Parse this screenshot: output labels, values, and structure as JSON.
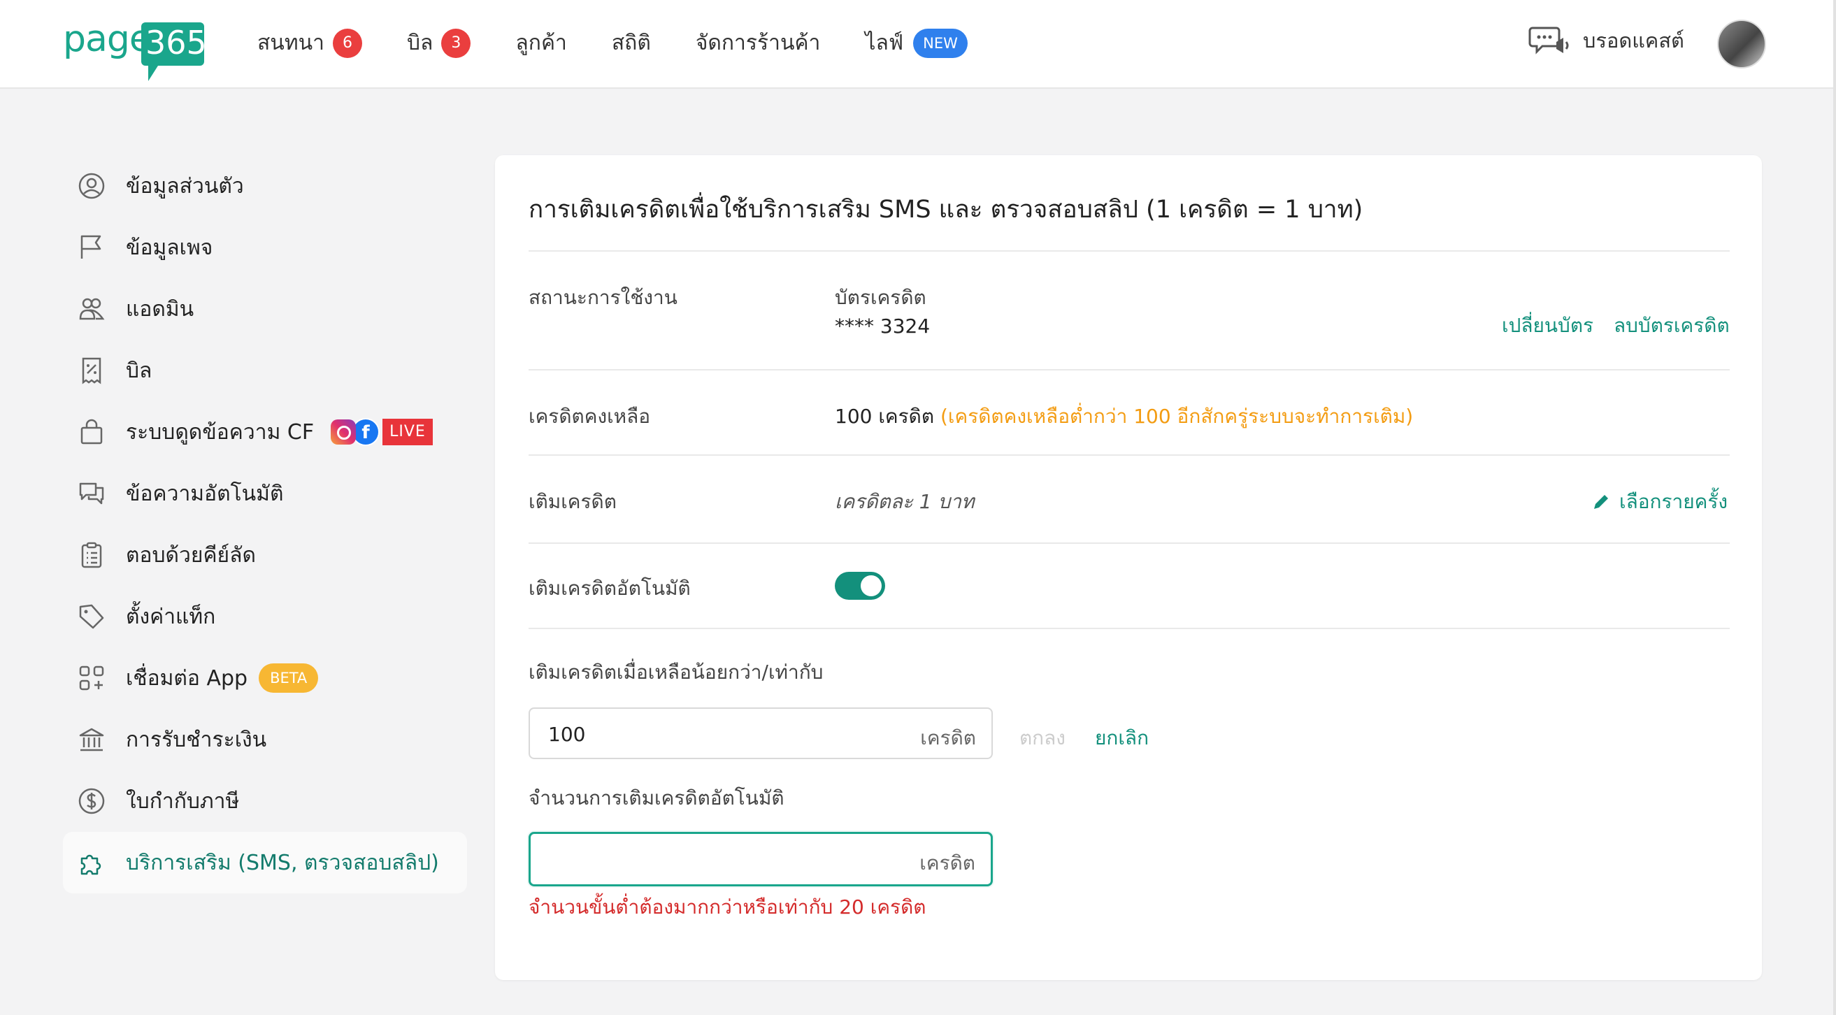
{
  "logo": {
    "text_page": "page",
    "text_365": "365"
  },
  "nav": [
    {
      "label": "สนทนา",
      "badge": "6"
    },
    {
      "label": "บิล",
      "badge": "3"
    },
    {
      "label": "ลูกค้า"
    },
    {
      "label": "สถิติ"
    },
    {
      "label": "จัดการร้านค้า"
    },
    {
      "label": "ไลฟ์",
      "tag": "NEW"
    }
  ],
  "header": {
    "broadcast_label": "บรอดแคสต์",
    "broadcast_icon": "megaphone-chat-icon"
  },
  "sidebar": {
    "items": [
      {
        "label": "ข้อมูลส่วนตัว",
        "icon": "user-circle-icon"
      },
      {
        "label": "ข้อมูลเพจ",
        "icon": "flag-icon"
      },
      {
        "label": "แอดมิน",
        "icon": "users-icon"
      },
      {
        "label": "บิล",
        "icon": "receipt-icon"
      },
      {
        "label": "ระบบดูดข้อความ CF",
        "icon": "shopping-bag-icon",
        "tag": "LIVE"
      },
      {
        "label": "ข้อความอัตโนมัติ",
        "icon": "chat-bubbles-icon"
      },
      {
        "label": "ตอบด้วยคีย์ลัด",
        "icon": "clipboard-list-icon"
      },
      {
        "label": "ตั้งค่าแท็ก",
        "icon": "tag-icon"
      },
      {
        "label": "เชื่อมต่อ App",
        "icon": "apps-icon",
        "tag": "BETA"
      },
      {
        "label": "การรับชำระเงิน",
        "icon": "bank-icon"
      },
      {
        "label": "ใบกำกับภาษี",
        "icon": "dollar-circle-icon"
      },
      {
        "label": "บริการเสริม (SMS, ตรวจสอบสลิป)",
        "icon": "puzzle-icon",
        "active": true
      }
    ]
  },
  "card": {
    "title": "การเติมเครดิตเพื่อใช้บริการเสริม SMS และ ตรวจสอบสลิป (1 เครดิต = 1 บาท)",
    "status": {
      "label": "สถานะการใช้งาน",
      "card_title": "บัตรเครดิต",
      "card_number": "**** 3324",
      "change_card": "เปลี่ยนบัตร",
      "delete_card": "ลบบัตรเครดิต"
    },
    "balance": {
      "label": "เครดิตคงเหลือ",
      "value": "100 เครดิต",
      "note": "(เครดิตคงเหลือต่ำกว่า 100 อีกสักครู่ระบบจะทำการเติม)"
    },
    "topup": {
      "label": "เติมเครดิต",
      "rate": "เครดิตละ 1 บาท",
      "choose": "เลือกรายครั้ง"
    },
    "auto": {
      "label": "เติมเครดิตอัตโนมัติ",
      "enabled": true
    },
    "threshold": {
      "label": "เติมเครดิตเมื่อเหลือน้อยกว่า/เท่ากับ",
      "value": "100",
      "suffix": "เครดิต",
      "ok": "ตกลง",
      "cancel": "ยกเลิก"
    },
    "amount": {
      "label": "จำนวนการเติมเครดิตอัตโนมัติ",
      "value": "",
      "suffix": "เครดิต",
      "error": "จำนวนขั้นต่ำต้องมากกว่าหรือเท่ากับ 20 เครดิต"
    }
  },
  "colors": {
    "brand": "#1aa68c",
    "link": "#13907c",
    "badge": "#ea3e3e",
    "warn": "#f39c12",
    "error": "#d42b2b"
  }
}
